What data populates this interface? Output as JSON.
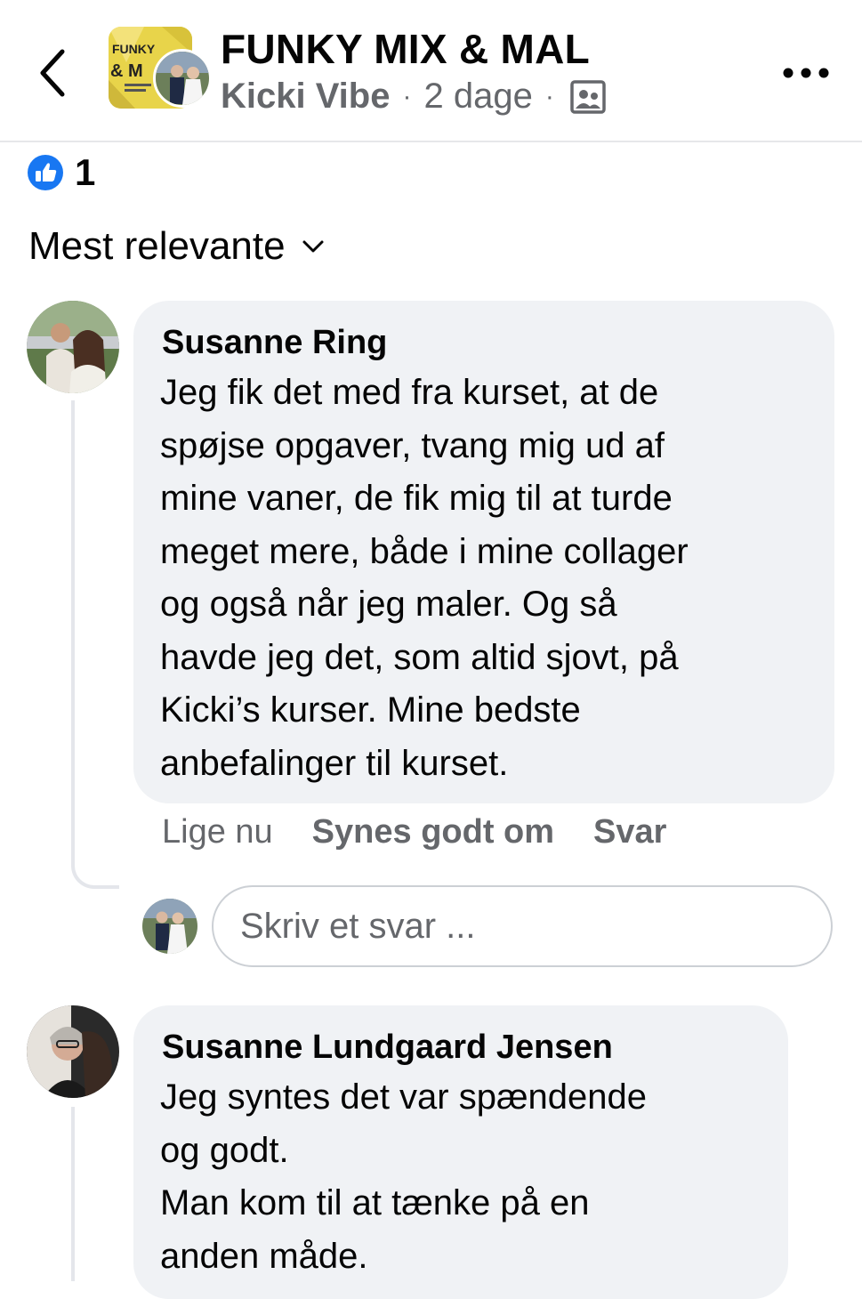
{
  "header": {
    "group_name": "FUNKY MIX & MAL",
    "author": "Kicki Vibe",
    "separator": "·",
    "time": "2 dage",
    "group_avatar_text": [
      "FUNKY",
      "& M"
    ],
    "icons": {
      "back": "chevron-left-icon",
      "audience": "group-audience-icon",
      "more": "more-horizontal-icon"
    }
  },
  "reactions": {
    "icon": "like-icon",
    "count": "1",
    "color": "#1877f2"
  },
  "sort": {
    "label": "Mest relevante",
    "icon": "chevron-down-icon"
  },
  "comments": [
    {
      "name": "Susanne Ring",
      "text": "Jeg fik det med fra kurset, at de\nspøjse opgaver, tvang mig ud af\nmine vaner, de fik mig til at turde\nmeget mere, både i mine collager\nog også når jeg maler. Og så\nhavde jeg det, som altid sjovt, på\nKicki’s kurser.  Mine bedste\nanbefalinger til kurset.",
      "time": "Lige nu",
      "like_label": "Synes godt om",
      "reply_label": "Svar"
    },
    {
      "name": "Susanne Lundgaard Jensen",
      "text": "Jeg syntes det var spændende\nog godt.\nMan kom til at tænke på en\nanden måde."
    }
  ],
  "reply_box": {
    "placeholder": "Skriv et svar ..."
  },
  "colors": {
    "bubble": "#f0f2f5",
    "secondary_text": "#65676b",
    "divider": "#e4e6eb"
  }
}
